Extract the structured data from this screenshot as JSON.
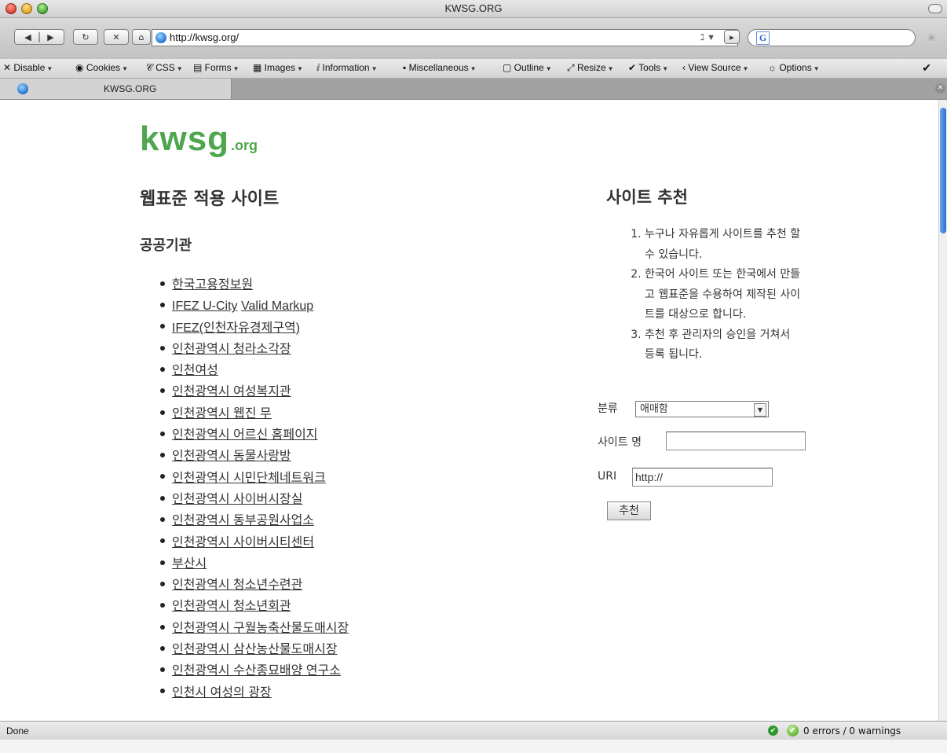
{
  "window": {
    "title": "KWSG.ORG"
  },
  "navbar": {
    "url": "http://kwsg.org/",
    "rss_label": "ℷ ▼"
  },
  "devbar": {
    "menus": [
      "Disable",
      "Cookies",
      "CSS",
      "Forms",
      "Images",
      "Information",
      "Miscellaneous",
      "Outline",
      "Resize",
      "Tools",
      "View Source",
      "Options"
    ]
  },
  "tab": {
    "label": "KWSG.ORG"
  },
  "logo": {
    "main": "kwsg",
    "suffix": ".org"
  },
  "main": {
    "heading": "웹표준 적용 사이트",
    "category": "공공기관",
    "sites": [
      {
        "label": "한국고용정보원"
      },
      {
        "label_a": "IFEZ U-City",
        "label_b": "Valid Markup"
      },
      {
        "label": "IFEZ(인천자유경제구역)"
      },
      {
        "label": "인천광역시 청라소각장"
      },
      {
        "label": "인천여성"
      },
      {
        "label": "인천광역시 여성복지관"
      },
      {
        "label": "인천광역시 웹진 무"
      },
      {
        "label": "인천광역시 어르신 홈페이지"
      },
      {
        "label": "인천광역시 동물사랑방"
      },
      {
        "label": "인천광역시 시민단체네트워크"
      },
      {
        "label": "인천광역시 사이버시장실"
      },
      {
        "label": "인천광역시 동부공원사업소"
      },
      {
        "label": "인천광역시 사이버시티센터"
      },
      {
        "label": "부산시"
      },
      {
        "label": "인천광역시 청소년수련관"
      },
      {
        "label": "인천광역시 청소년회관"
      },
      {
        "label": "인천광역시 구월농축산물도매시장"
      },
      {
        "label": "인천광역시 삼산농산물도매시장"
      },
      {
        "label": "인천광역시 수산종묘배양 연구소"
      },
      {
        "label": "인천시 여성의 광장"
      }
    ]
  },
  "sidebar": {
    "heading": "사이트 추천",
    "rules": [
      "누구나 자유롭게 사이트를 추천 할 수 있습니다.",
      "한국어 사이트 또는 한국에서 만들고 웹표준을 수용하여 제작된 사이트를 대상으로 합니다.",
      "추천 후 관리자의 승인을 거쳐서 등록 됩니다."
    ],
    "form": {
      "category_label": "분류",
      "category_value": "애매함",
      "name_label": "사이트 명",
      "name_value": "",
      "uri_label": "URI",
      "uri_value": "http://",
      "submit_label": "추천"
    }
  },
  "statusbar": {
    "status": "Done",
    "validator": "0 errors / 0 warnings"
  },
  "colors": {
    "logo": "#4ea64e",
    "text": "#333333"
  }
}
